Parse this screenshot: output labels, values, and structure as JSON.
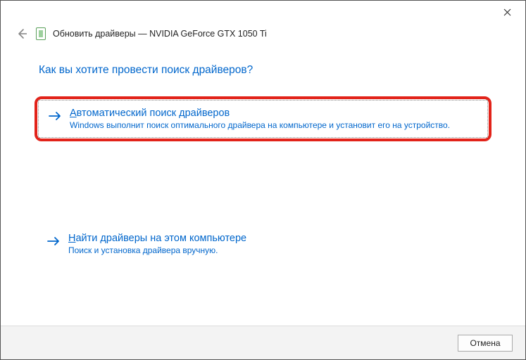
{
  "titlebar": {
    "close_label": "Close"
  },
  "header": {
    "title": "Обновить драйверы — NVIDIA GeForce GTX 1050 Ti"
  },
  "main": {
    "question": "Как вы хотите провести поиск драйверов?",
    "options": [
      {
        "accel": "А",
        "title_rest": "втоматический поиск драйверов",
        "desc": "Windows выполнит поиск оптимального драйвера на компьютере и установит его на устройство."
      },
      {
        "accel": "Н",
        "title_rest": "айти драйверы на этом компьютере",
        "desc": "Поиск и установка драйвера вручную."
      }
    ]
  },
  "footer": {
    "cancel_label": "Отмена"
  }
}
